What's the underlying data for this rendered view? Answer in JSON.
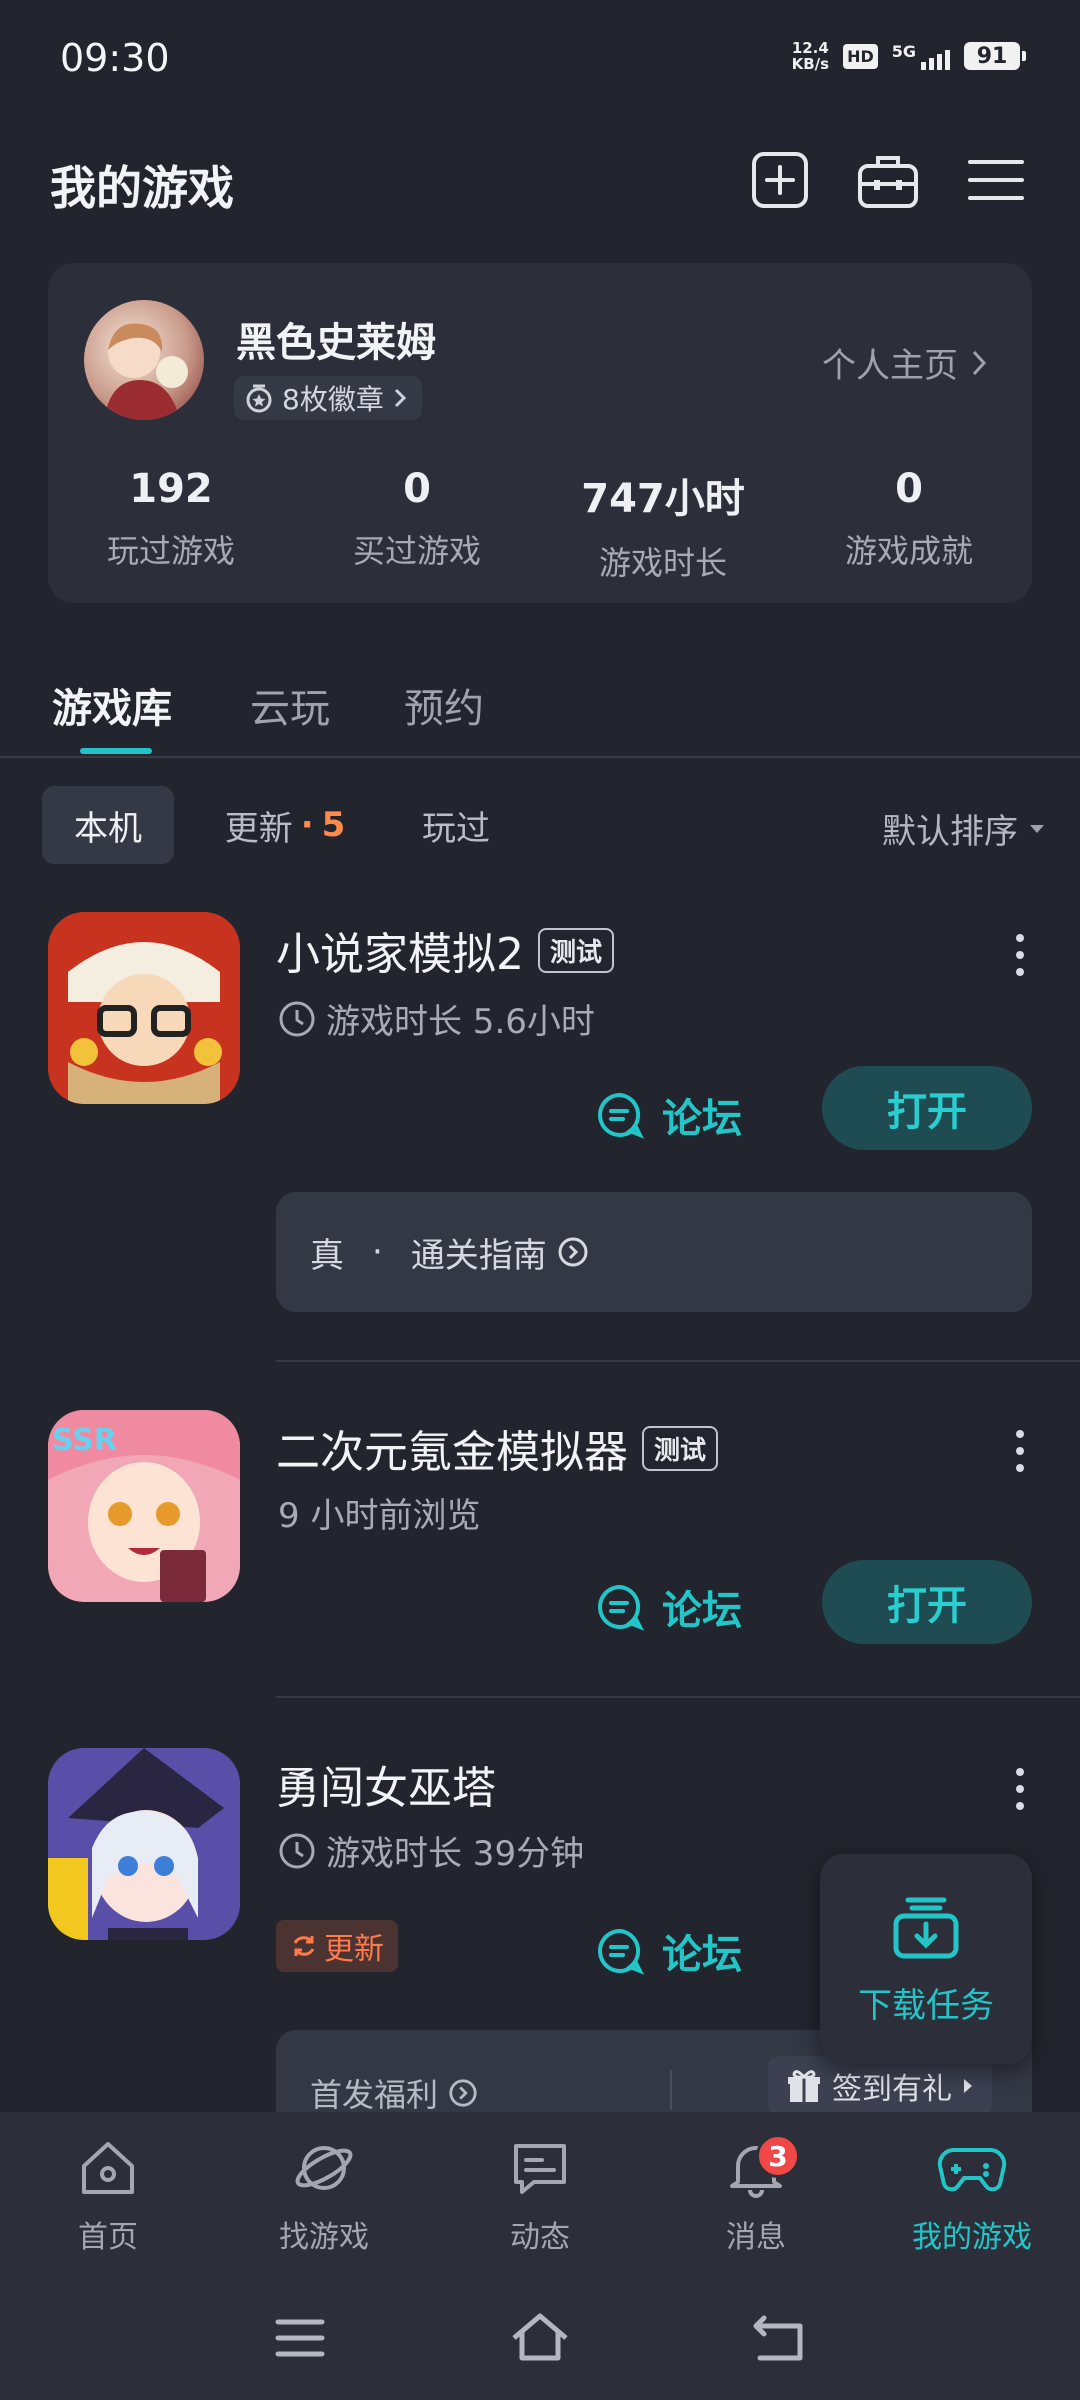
{
  "status_bar": {
    "time": "09:30",
    "net_speed_value": "12.4",
    "net_speed_unit": "KB/s",
    "hd": "HD",
    "network": "5G",
    "battery": "91"
  },
  "header": {
    "title": "我的游戏",
    "icons": [
      "add-square-icon",
      "toolbox-icon",
      "menu-icon"
    ]
  },
  "profile": {
    "username": "黑色史莱姆",
    "badges": "8枚徽章",
    "homepage_link": "个人主页",
    "stats": [
      {
        "value": "192",
        "label": "玩过游戏"
      },
      {
        "value": "0",
        "label": "买过游戏"
      },
      {
        "value": "747小时",
        "label": "游戏时长"
      },
      {
        "value": "0",
        "label": "游戏成就"
      }
    ]
  },
  "tabs": [
    "游戏库",
    "云玩",
    "预约"
  ],
  "filters": {
    "local": "本机",
    "update": "更新",
    "update_dot": "·",
    "update_count": "5",
    "played": "玩过",
    "sort": "默认排序"
  },
  "games": [
    {
      "title": "小说家模拟2",
      "tag": "测试",
      "meta": "游戏时长 5.6小时",
      "forum": "论坛",
      "action": "打开",
      "guide_prefix": "真",
      "guide_sep": "·",
      "guide": "通关指南"
    },
    {
      "title": "二次元氪金模拟器",
      "tag": "测试",
      "meta": "9 小时前浏览",
      "forum": "论坛",
      "action": "打开"
    },
    {
      "title": "勇闯女巫塔",
      "meta": "游戏时长 39分钟",
      "update_tag": "更新",
      "forum": "论坛",
      "welfare": "首发福利",
      "checkin": "签到有礼"
    }
  ],
  "download_task": "下载任务",
  "bottom_nav": [
    {
      "label": "首页",
      "icon": "home-icon"
    },
    {
      "label": "找游戏",
      "icon": "planet-icon"
    },
    {
      "label": "动态",
      "icon": "message-icon"
    },
    {
      "label": "消息",
      "icon": "bell-icon",
      "badge": "3"
    },
    {
      "label": "我的游戏",
      "icon": "gamepad-icon",
      "active": true
    }
  ],
  "colors": {
    "background": "#23252e",
    "card": "#2c2f39",
    "accent": "#22c6c8",
    "update_orange": "#ff8a4c",
    "badge_red": "#f04747"
  }
}
